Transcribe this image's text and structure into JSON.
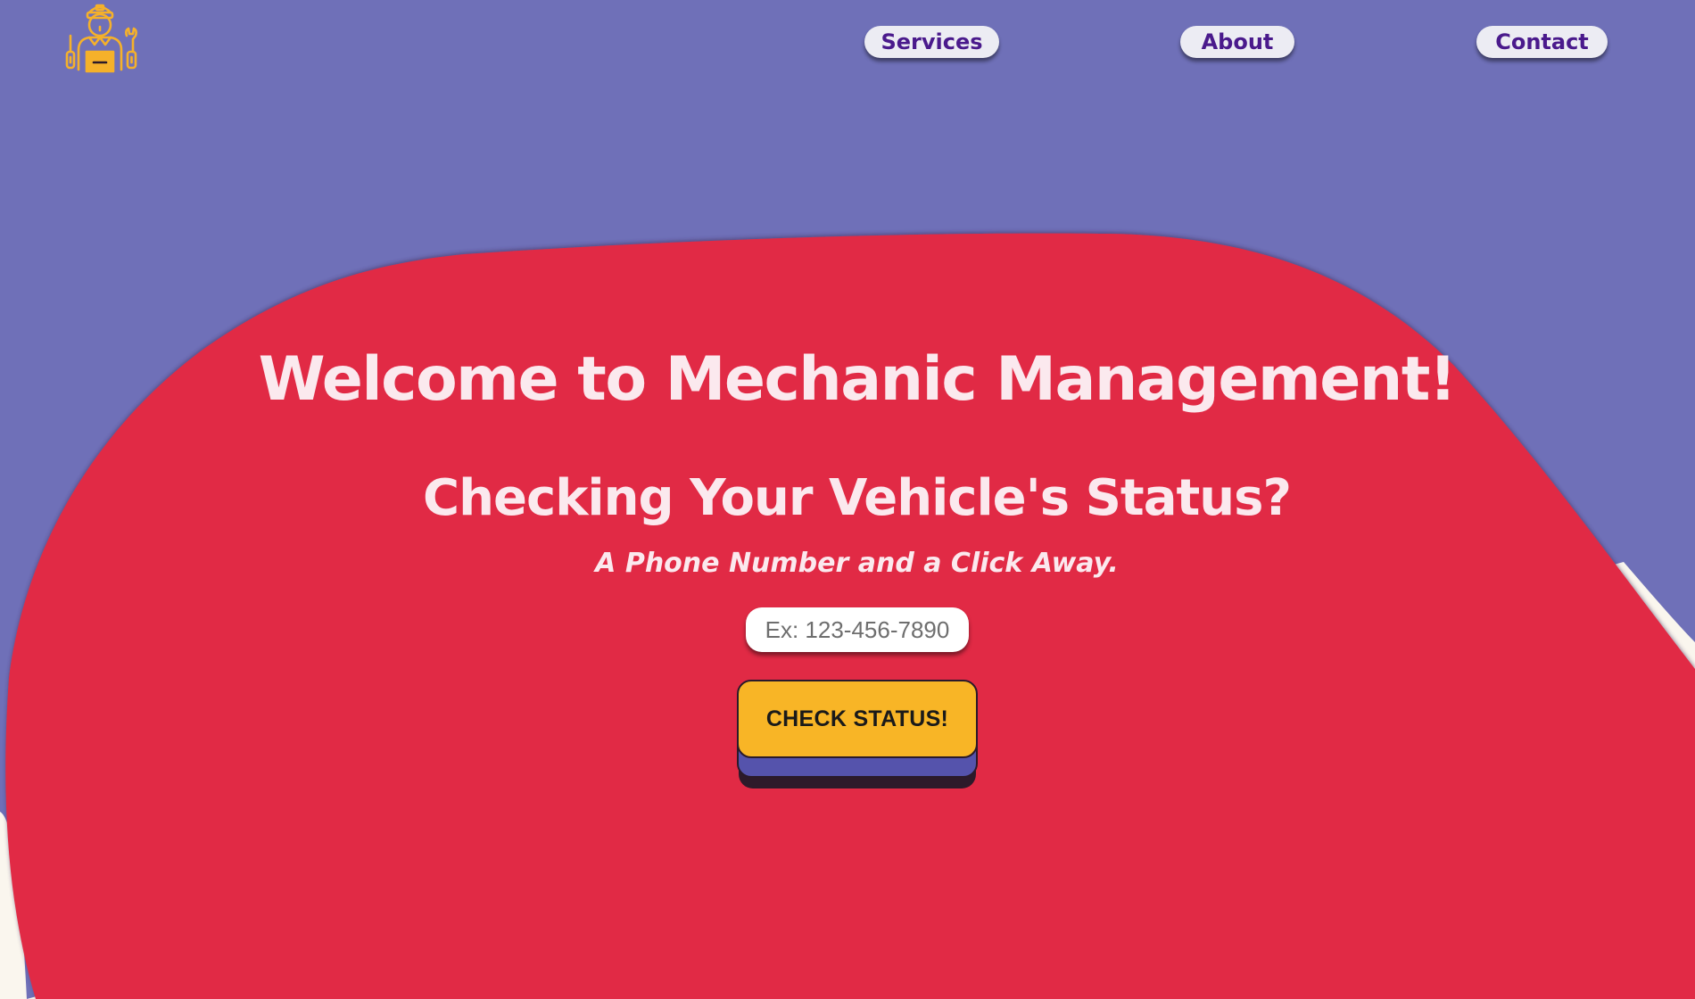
{
  "colors": {
    "background": "#6f70b8",
    "blob": "#e12b45",
    "cream": "#faf6ee",
    "nav_bg": "#ececf3",
    "nav_text": "#4a1a8c",
    "heading_text": "#fbe9ee",
    "button_face": "#f8b526",
    "button_mid": "#5553ac",
    "button_shadow": "#2d1a2a",
    "logo": "#f5b12a"
  },
  "header": {
    "logo_icon": "mechanic-icon",
    "nav": {
      "services": "Services",
      "about": "About",
      "contact": "Contact"
    }
  },
  "hero": {
    "title": "Welcome to Mechanic Management!",
    "subtitle": "Checking Your Vehicle's Status?",
    "tagline": "A Phone Number and a Click Away.",
    "phone_placeholder": "Ex: 123-456-7890",
    "phone_value": "",
    "button_label": "CHECK STATUS!"
  }
}
